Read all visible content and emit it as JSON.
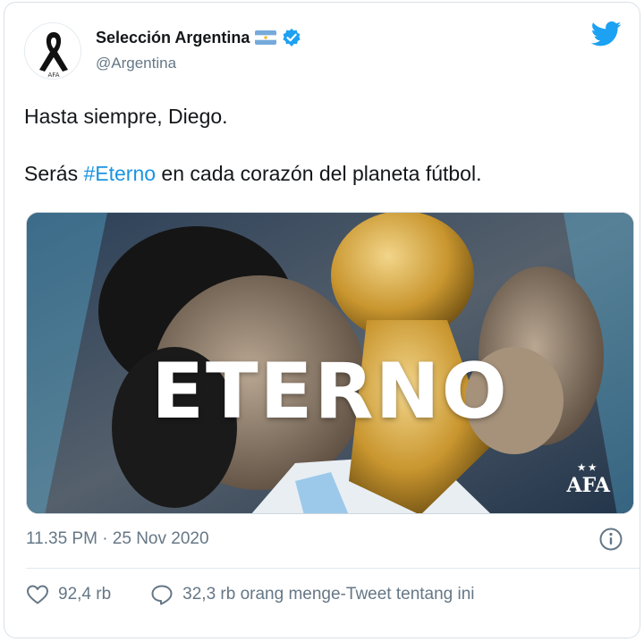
{
  "tweet": {
    "display_name": "Selección Argentina",
    "handle": "@Argentina",
    "text_line1": "Hasta siempre, Diego.",
    "text_line2_before": "Serás ",
    "hashtag": "#Eterno",
    "text_line2_after": " en cada corazón del planeta fútbol.",
    "timestamp": "11.35 PM · 25 Nov 2020",
    "likes": "92,4 rb",
    "retweets_label": "32,3 rb orang menge-Tweet tentang ini"
  },
  "media": {
    "overlay_text": "ETERNO",
    "logo_text": "AFA",
    "logo_stars": "★★"
  },
  "icons": {
    "avatar": "black-ribbon-icon",
    "flag": "argentina-flag-icon",
    "verified": "verified-badge-icon",
    "brand": "twitter-bird-icon",
    "info": "info-icon",
    "like": "heart-icon",
    "reply": "speech-bubble-icon"
  },
  "colors": {
    "brand_blue": "#1da1f2",
    "hashtag": "#1b95e0",
    "secondary_text": "#657786",
    "text": "#14171a"
  }
}
